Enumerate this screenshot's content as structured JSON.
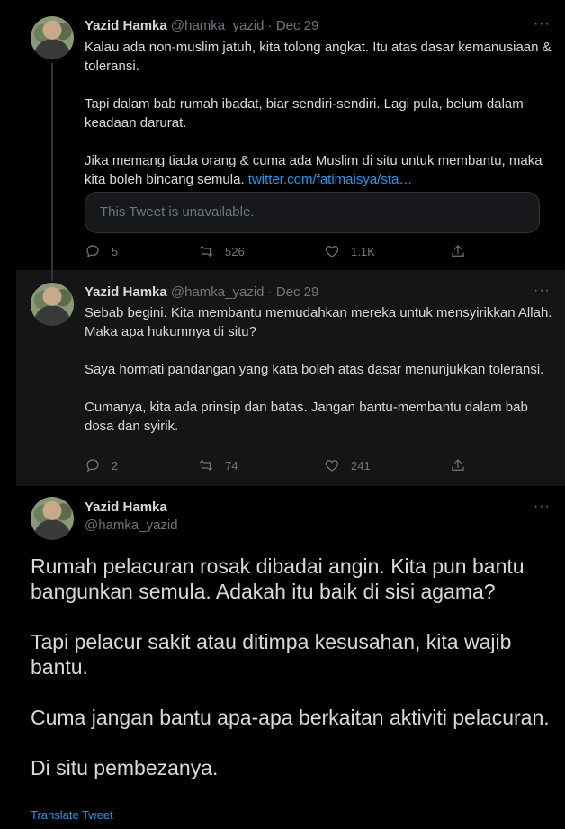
{
  "tweets": [
    {
      "name": "Yazid Hamka",
      "handle": "@hamka_yazid",
      "date": "Dec 29",
      "paragraphs": [
        "Kalau ada non-muslim jatuh, kita tolong angkat. Itu atas dasar kemanusiaan & toleransi.",
        "Tapi dalam bab rumah ibadat, biar sendiri-sendiri. Lagi pula, belum dalam keadaan darurat."
      ],
      "last_paragraph": "Jika memang tiada orang & cuma ada Muslim di situ untuk membantu, maka kita boleh bincang semula.",
      "link": "twitter.com/fatimaisya/sta…",
      "quote_text": "This Tweet is unavailable.",
      "replies": "5",
      "retweets": "526",
      "likes": "1.1K"
    },
    {
      "name": "Yazid Hamka",
      "handle": "@hamka_yazid",
      "date": "Dec 29",
      "paragraphs": [
        "Sebab begini. Kita membantu memudahkan mereka untuk mensyirikkan Allah. Maka apa hukumnya di situ?",
        "Saya hormati pandangan yang kata boleh atas dasar menunjukkan toleransi.",
        "Cumanya, kita ada prinsip dan batas. Jangan bantu-membantu dalam bab dosa dan syirik."
      ],
      "replies": "2",
      "retweets": "74",
      "likes": "241"
    },
    {
      "name": "Yazid Hamka",
      "handle": "@hamka_yazid",
      "paragraphs": [
        "Rumah pelacuran rosak dibadai angin. Kita pun bantu bangunkan semula. Adakah itu baik di sisi agama?",
        "Tapi pelacur sakit atau ditimpa kesusahan, kita wajib bantu.",
        "Cuma jangan bantu apa-apa berkaitan aktiviti pelacuran.",
        "Di situ pembezanya."
      ],
      "translate": "Translate Tweet"
    }
  ],
  "dot": "·",
  "more": "···",
  "icons": [
    "more-icon",
    "reply-icon",
    "retweet-icon",
    "like-icon",
    "share-icon",
    "avatar"
  ],
  "colors": {
    "background": "#000000",
    "highlight": "#151515",
    "text": "#d9d9d9",
    "muted": "#6e767d",
    "link": "#1d9bf0"
  }
}
